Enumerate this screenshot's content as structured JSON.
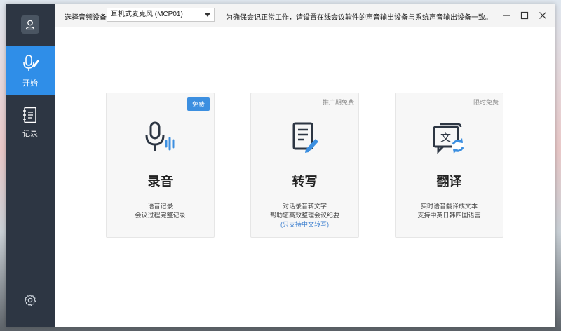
{
  "topbar": {
    "device_label": "选择音频设备",
    "device_selected": "耳机式麦克风 (MCP01)",
    "hint": "为确保会记正常工作，请设置在线会议软件的声音输出设备与系统声音输出设备一致。"
  },
  "sidebar": {
    "items": [
      {
        "label": "开始",
        "icon": "mic-pen-icon",
        "active": true
      },
      {
        "label": "记录",
        "icon": "notebook-icon",
        "active": false
      }
    ]
  },
  "cards": [
    {
      "badge": "免费",
      "title": "录音",
      "lines": [
        "语音记录",
        "会议过程完整记录"
      ],
      "note": "",
      "icon": "mic-wave-icon"
    },
    {
      "badge": "推广期免费",
      "title": "转写",
      "lines": [
        "对话录音转文字",
        "帮助您高效整理会议纪要"
      ],
      "note": "(只支持中文转写)",
      "icon": "doc-pen-icon"
    },
    {
      "badge": "限时免费",
      "title": "翻译",
      "lines": [
        "实时语音翻译成文本",
        "支持中英日韩四国语言"
      ],
      "note": "",
      "icon": "translate-icon"
    }
  ],
  "colors": {
    "accent": "#2f8ee8",
    "sidebar": "#2d3643",
    "badge": "#3c8fe0"
  }
}
